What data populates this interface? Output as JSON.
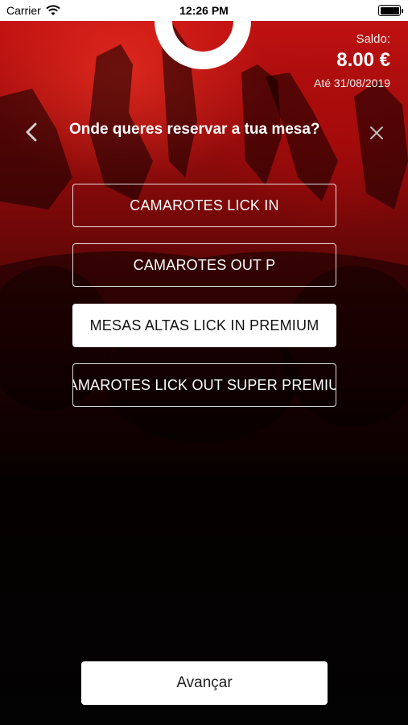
{
  "status_bar": {
    "carrier": "Carrier",
    "time": "12:26 PM"
  },
  "balance": {
    "label": "Saldo:",
    "amount": "8.00 €",
    "valid_until": "Até 31/08/2019"
  },
  "header": {
    "question": "Onde queres reservar a tua mesa?"
  },
  "options": [
    {
      "label": "CAMAROTES LICK IN",
      "selected": false
    },
    {
      "label": "CAMAROTES OUT P",
      "selected": false
    },
    {
      "label": "MESAS ALTAS LICK IN PREMIUM",
      "selected": true
    },
    {
      "label": "CAMAROTES LICK OUT SUPER PREMIUM",
      "selected": false
    }
  ],
  "advance_button": {
    "label": "Avançar"
  },
  "colors": {
    "accent_red": "#c81212",
    "background": "#000000",
    "button": "#ffffff"
  }
}
